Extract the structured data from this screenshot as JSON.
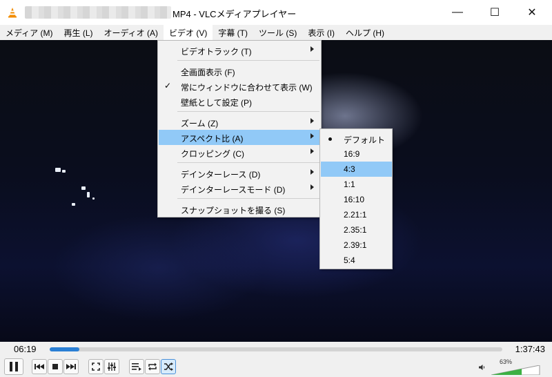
{
  "window": {
    "title": "MP4 - VLCメディアプレイヤー",
    "minimize": "—",
    "maximize": "☐",
    "close": "✕"
  },
  "menubar": [
    "メディア (M)",
    "再生 (L)",
    "オーディオ (A)",
    "ビデオ (V)",
    "字幕 (T)",
    "ツール (S)",
    "表示 (I)",
    "ヘルプ (H)"
  ],
  "video_menu": {
    "video_track": "ビデオトラック (T)",
    "fullscreen": "全画面表示 (F)",
    "fit_window": "常にウィンドウに合わせて表示 (W)",
    "wallpaper": "壁紙として設定 (P)",
    "zoom": "ズーム (Z)",
    "aspect": "アスペクト比 (A)",
    "crop": "クロッピング (C)",
    "deinterlace": "デインターレース (D)",
    "deinterlace_mode": "デインターレースモード (D)",
    "snapshot": "スナップショットを撮る (S)",
    "check_mark": "✓"
  },
  "aspect_menu": {
    "items": [
      "デフォルト",
      "16:9",
      "4:3",
      "1:1",
      "16:10",
      "2.21:1",
      "2.35:1",
      "2.39:1",
      "5:4"
    ],
    "selected": "デフォルト",
    "hovered": "4:3"
  },
  "playback": {
    "elapsed": "06:19",
    "total": "1:37:43",
    "progress": 0.065
  },
  "volume": {
    "label": "63%",
    "level": 0.63
  },
  "icons": {
    "pause": "pause-icon",
    "prev": "previous-icon",
    "stop": "stop-icon",
    "next": "next-icon",
    "fullscreen": "fullscreen-icon",
    "extended": "extended-settings-icon",
    "playlist": "playlist-icon",
    "loop": "loop-icon",
    "shuffle": "shuffle-icon",
    "speaker": "speaker-icon"
  },
  "colors": {
    "highlight": "#91c9f7",
    "progress": "#2a7fd4",
    "volume": "#3cb043"
  }
}
